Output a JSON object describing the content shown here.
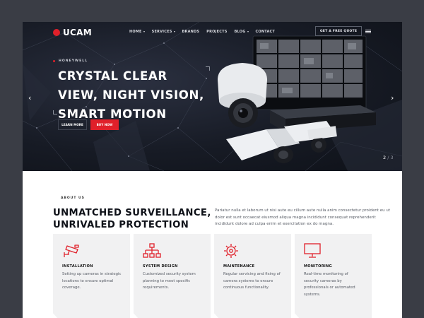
{
  "brand": {
    "name": "UCAM",
    "accent": "#e0202a",
    "dark": "#171b25"
  },
  "nav": {
    "items": [
      {
        "label": "HOME",
        "dropdown": true
      },
      {
        "label": "SERVICES",
        "dropdown": true
      },
      {
        "label": "BRANDS",
        "dropdown": false
      },
      {
        "label": "PROJECTS",
        "dropdown": false
      },
      {
        "label": "BLOG",
        "dropdown": true
      },
      {
        "label": "CONTACT",
        "dropdown": false
      }
    ],
    "quote_button": "GET A FREE QUOTE",
    "menu_icon": "hamburger-icon"
  },
  "hero": {
    "eyebrow": "HONEYWELL",
    "title_lines": [
      "CRYSTAL CLEAR",
      "VIEW, NIGHT VISION,",
      "SMART MOTION"
    ],
    "learn_more": "LEARN MORE",
    "buy_now": "BUY NOW",
    "slide_current": "2",
    "slide_separator": "/",
    "slide_total": "3",
    "prev_icon": "chevron-left-icon",
    "next_icon": "chevron-right-icon"
  },
  "about": {
    "label": "ABOUT US",
    "title_lines": [
      "UNMATCHED SURVEILLANCE,",
      "UNRIVALED PROTECTION"
    ],
    "text": "Pariatur nulla et laborum ut nisi aute eu cillum aute nulla anim consectetur proident eu ut dolor est sunt occaecat eiusmod aliqua magna incididunt consequat reprehenderit incididunt dolore ad culpa enim et exercitation ex do magna."
  },
  "services": [
    {
      "icon": "cctv-camera-icon",
      "title": "INSTALLATION",
      "desc": "Setting up cameras in strategic locations to ensure optimal coverage."
    },
    {
      "icon": "network-diagram-icon",
      "title": "SYSTEM DESIGN",
      "desc": "Customized security system planning to meet specific requirements."
    },
    {
      "icon": "gear-icon",
      "title": "MAINTENANCE",
      "desc": "Regular servicing and fixing of camera systems to ensure continuous functionality."
    },
    {
      "icon": "monitor-icon",
      "title": "MONITORING",
      "desc": "Real-time monitoring of security cameras by professionals or automated systems."
    }
  ]
}
